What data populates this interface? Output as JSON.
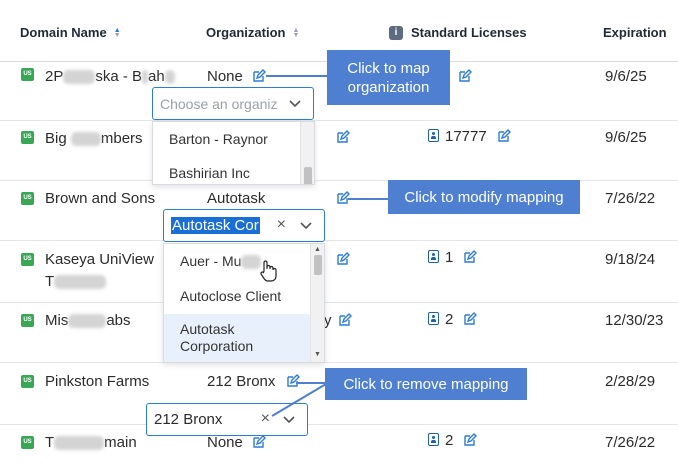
{
  "columns": {
    "domain": "Domain Name",
    "organization": "Organization",
    "licenses": "Standard Licenses",
    "expiration": "Expiration",
    "info_glyph": "i"
  },
  "region_badge": "US",
  "rows": [
    {
      "name_prefix": "2P",
      "name_mid": "ska - B",
      "name_suffix": "ah",
      "org": "None",
      "licenses": "",
      "expiration": "9/6/25"
    },
    {
      "name_prefix": "Big ",
      "name_suffix": "mbers",
      "org": "",
      "licenses": "17777",
      "expiration": "9/6/25"
    },
    {
      "name": "Brown and Sons",
      "org": "Autotask",
      "licenses": "",
      "expiration": "7/26/22"
    },
    {
      "name": "Kaseya UniView",
      "name_line2_prefix": "T",
      "org": "",
      "licenses": "1",
      "expiration": "9/18/24"
    },
    {
      "name_prefix": "Mis",
      "name_suffix": "abs",
      "org_suffix": "y",
      "licenses": "2",
      "expiration": "12/30/23"
    },
    {
      "name": "Pinkston Farms",
      "org": "212 Bronx",
      "licenses": "",
      "expiration": "2/28/29"
    },
    {
      "name_prefix": "T",
      "name_suffix": "main",
      "org": "None",
      "licenses": "2",
      "expiration": "7/26/22"
    }
  ],
  "select1": {
    "placeholder": "Choose an organiz"
  },
  "select1_options": [
    "Barton - Raynor",
    "Bashirian Inc"
  ],
  "select2": {
    "value": "Autotask Cor",
    "clear": "×"
  },
  "select2_options": [
    {
      "label": "Auer - Mu"
    },
    {
      "label": "Autoclose Client"
    },
    {
      "label": "Autotask Corporation"
    }
  ],
  "select3": {
    "value": "212 Bronx",
    "clear": "×"
  },
  "callouts": {
    "map": "Click to map organization",
    "modify": "Click to modify mapping",
    "remove": "Click to remove mapping"
  },
  "colors": {
    "accent": "#2d7bd6",
    "callout": "#4f7fd0",
    "badge": "#3aa757",
    "license_icon": "#1f5faa"
  },
  "icons": [
    "sort-asc-icon",
    "sort-icon",
    "info-icon",
    "edit-icon",
    "license-icon",
    "chevron-down-icon",
    "clear-icon",
    "hand-cursor-icon",
    "us-flag-badge"
  ]
}
